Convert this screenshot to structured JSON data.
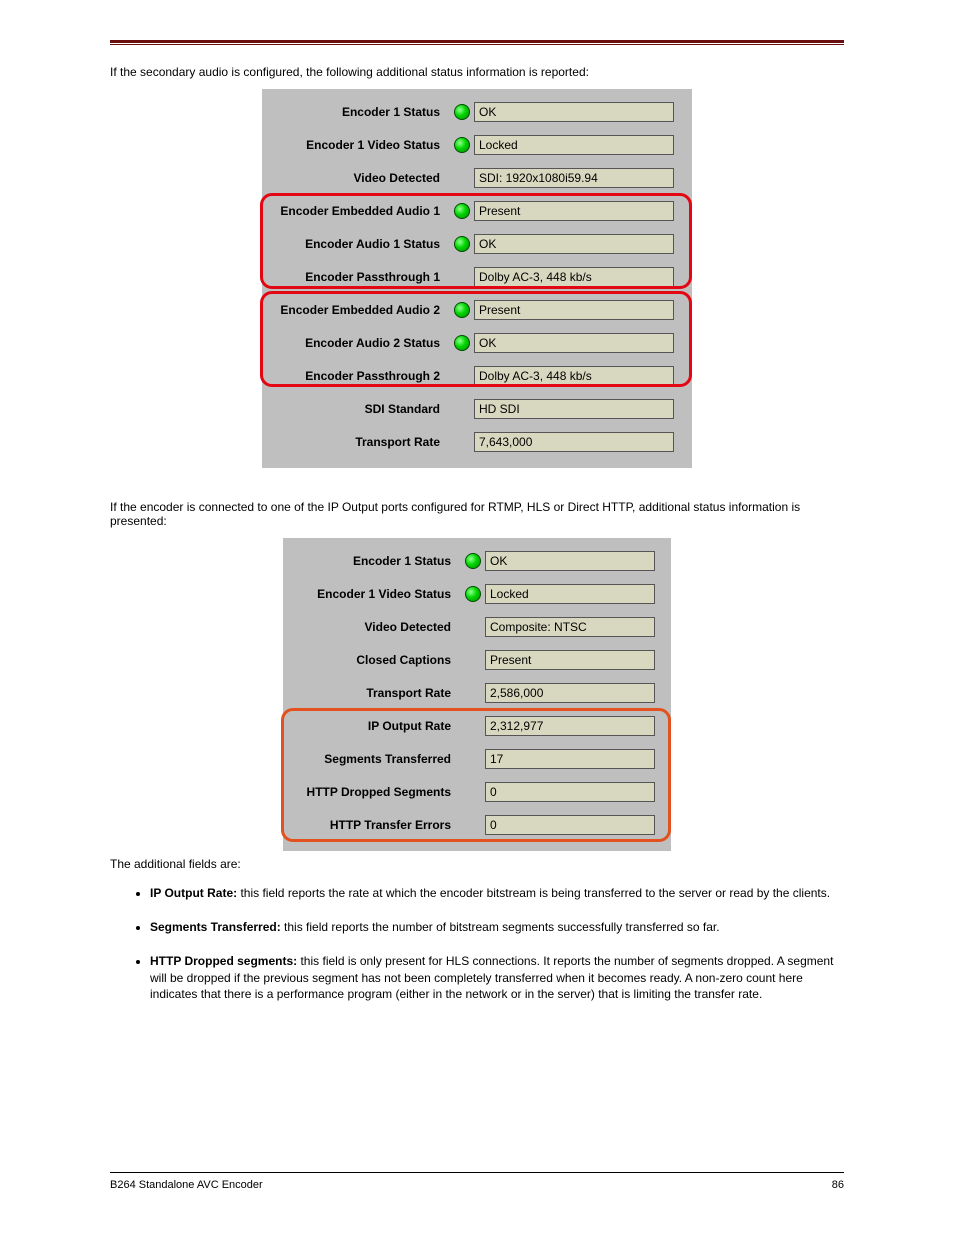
{
  "intro": "If the secondary audio is configured, the following additional status information is reported:",
  "panel1": {
    "rows": [
      {
        "label": "Encoder 1 Status",
        "led": true,
        "value": "OK"
      },
      {
        "label": "Encoder 1 Video Status",
        "led": true,
        "value": "Locked"
      },
      {
        "label": "Video Detected",
        "led": false,
        "value": "SDI: 1920x1080i59.94"
      },
      {
        "label": "Encoder Embedded Audio 1",
        "led": true,
        "value": "Present"
      },
      {
        "label": "Encoder Audio 1 Status",
        "led": true,
        "value": "OK"
      },
      {
        "label": "Encoder Passthrough 1",
        "led": false,
        "value": "Dolby AC-3, 448 kb/s"
      },
      {
        "label": "Encoder Embedded Audio 2",
        "led": true,
        "value": "Present"
      },
      {
        "label": "Encoder Audio 2 Status",
        "led": true,
        "value": "OK"
      },
      {
        "label": "Encoder Passthrough 2",
        "led": false,
        "value": "Dolby AC-3, 448 kb/s"
      },
      {
        "label": "SDI Standard",
        "led": false,
        "value": "HD SDI"
      },
      {
        "label": "Transport Rate",
        "led": false,
        "value": "7,643,000"
      }
    ]
  },
  "bridge": "If the encoder is connected to one of the IP Output ports configured for RTMP, HLS or Direct HTTP, additional status information is presented:",
  "panel2": {
    "rows": [
      {
        "label": "Encoder 1 Status",
        "led": true,
        "value": "OK"
      },
      {
        "label": "Encoder 1 Video Status",
        "led": true,
        "value": "Locked"
      },
      {
        "label": "Video Detected",
        "led": false,
        "value": "Composite: NTSC"
      },
      {
        "label": "Closed Captions",
        "led": false,
        "value": "Present"
      },
      {
        "label": "Transport Rate",
        "led": false,
        "value": "2,586,000"
      },
      {
        "label": "IP Output Rate",
        "led": false,
        "value": "2,312,977"
      },
      {
        "label": "Segments Transferred",
        "led": false,
        "value": "17"
      },
      {
        "label": "HTTP Dropped Segments",
        "led": false,
        "value": "0"
      },
      {
        "label": "HTTP Transfer Errors",
        "led": false,
        "value": "0"
      }
    ]
  },
  "caption2": "The additional fields are:",
  "bullets": [
    {
      "bold": "IP Output Rate:",
      "text": " this field reports the rate at which the encoder bitstream is being transferred to the server or read by the clients."
    },
    {
      "bold": "Segments Transferred:",
      "text": " this field reports the number of bitstream segments successfully transferred so far."
    },
    {
      "bold": "HTTP Dropped segments:",
      "text": " this field is only present for HLS connections. It reports the number of segments dropped. A segment will be dropped if the previous segment has not been completely transferred when it becomes ready. A non-zero count here indicates that there is a performance program (either in the network or in the server) that is limiting the transfer rate."
    }
  ],
  "footer_left": "B264 Standalone AVC Encoder",
  "footer_right": "86"
}
